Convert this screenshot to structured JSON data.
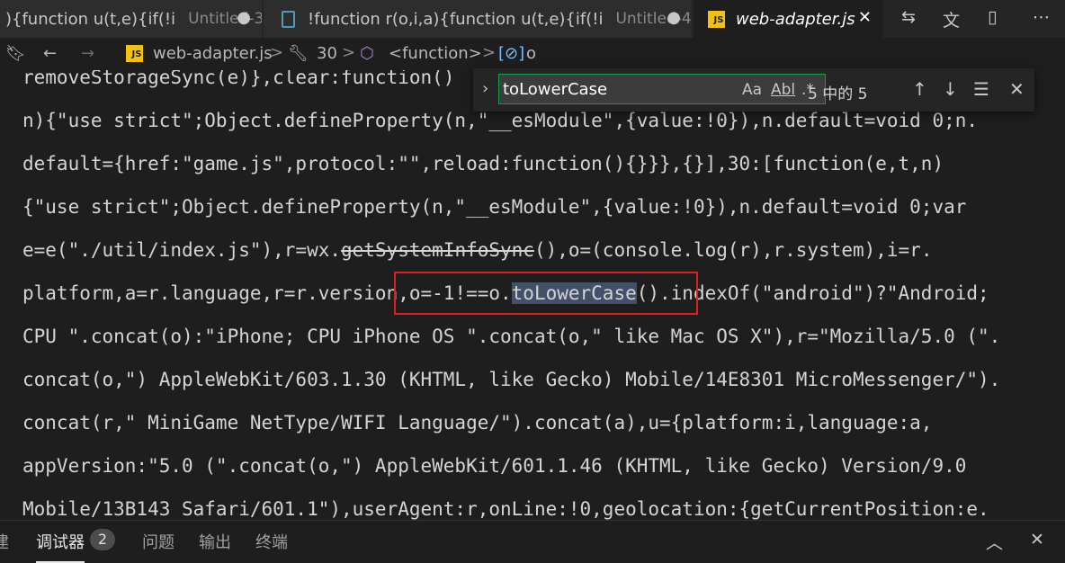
{
  "tabs": [
    {
      "title": "){function u(t,e){if(!i",
      "desc": "Untitled-3",
      "close": "●"
    },
    {
      "title": "!function r(o,i,a){function u(t,e){if(!i",
      "desc": "Untitled-4",
      "close": "●"
    },
    {
      "title": "web-adapter.js",
      "close": "✕",
      "icon_text": "JS"
    }
  ],
  "breadcrumb": {
    "file": "web-adapter.js",
    "sep": ">",
    "item1": "30",
    "item2": "<function>",
    "item3": "o"
  },
  "editor": {
    "l1": "removeStorageSync(e)},clear:function()",
    "l2": "n){\"use strict\";Object.defineProperty(n,\"__esModule\",{value:!0}),n.default=void 0;n.",
    "l3": "default={href:\"game.js\",protocol:\"\",reload:function(){}}},{}],30:[function(e,t,n)",
    "l4": "{\"use strict\";Object.defineProperty(n,\"__esModule\",{value:!0}),n.default=void 0;var",
    "l5a": "e=e(\"./util/index.js\"),r=wx.",
    "l5b": "getSystemInfoSync",
    "l5c": "(),o=(console.log(r),r.system),i=r.",
    "l6a": "platform,a=r.language,r=r.version,o=-1!==o.",
    "l6b": "toLowerCase",
    "l6c": "().indexOf(\"android\")?\"Android;",
    "l7": "CPU \".concat(o):\"iPhone; CPU iPhone OS \".concat(o,\" like Mac OS X\"),r=\"Mozilla/5.0 (\".",
    "l8": "concat(o,\") AppleWebKit/603.1.30 (KHTML, like Gecko) Mobile/14E8301 MicroMessenger/\").",
    "l9": "concat(r,\" MiniGame NetType/WIFI Language/\").concat(a),u={platform:i,language:a,",
    "l10": "appVersion:\"5.0 (\".concat(o,\") AppleWebKit/601.1.46 (KHTML, like Gecko) Version/9.0",
    "l11": "Mobile/13B143 Safari/601.1\"),userAgent:r,onLine:!0,geolocation:{getCurrentPosition:e."
  },
  "find": {
    "query": "toLowerCase",
    "match_case": "Aa",
    "whole_word": "Abl",
    "regex": ".*",
    "count": "5 中的 5"
  },
  "panel": {
    "tab0": "建",
    "tab1": "调试器",
    "badge": "2",
    "tab2": "问题",
    "tab3": "输出",
    "tab4": "终端"
  },
  "colors": {
    "background": "#1e1e1e",
    "find_border": "#0e9e46",
    "annotation_box": "#e02020",
    "match_highlight": "#42506a",
    "js_icon": "#f4c20d"
  }
}
